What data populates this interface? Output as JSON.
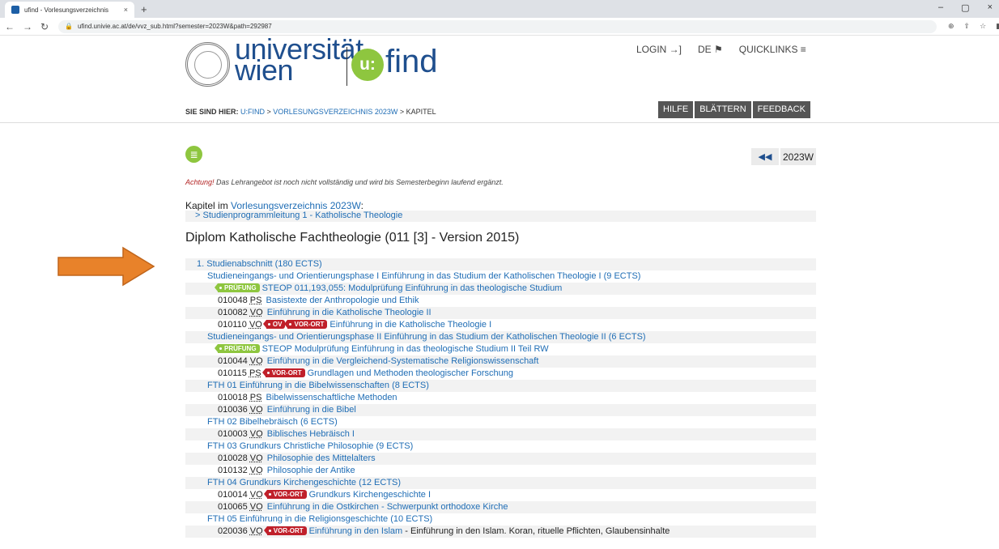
{
  "browser": {
    "tab_title": "ufind - Vorlesungsverzeichnis",
    "tab_close": "×",
    "new_tab": "+",
    "url": "ufind.univie.ac.at/de/vvz_sub.html?semester=2023W&path=292987",
    "win_min": "–",
    "win_max": "▢",
    "win_close": "×"
  },
  "header": {
    "logo_line1": "universität",
    "logo_line2": "wien",
    "ufind_mark": "u:",
    "ufind_text": "find",
    "login": "LOGIN →]",
    "lang": "DE ⚑",
    "quicklinks": "QUICKLINKS ≡",
    "breadcrumb_label": "SIE SIND HIER:",
    "breadcrumb_1": "U:FIND",
    "breadcrumb_2": "VORLESUNGSVERZEICHNIS 2023W",
    "breadcrumb_3": "KAPITEL",
    "btn_help": "HILFE",
    "btn_browse": "BLÄTTERN",
    "btn_feedback": "FEEDBACK"
  },
  "content": {
    "semester_back": "◀◀",
    "semester": "2023W",
    "warn_red": "Achtung!",
    "warn_text": " Das Lehrangebot ist noch nicht vollständig und wird bis Semesterbeginn laufend ergänzt.",
    "chapter_prefix": "Kapitel im ",
    "chapter_link": "Vorlesungsverzeichnis 2023W",
    "chapter_suffix": ":",
    "chapter_sub": "> Studienprogrammleitung 1 - Katholische Theologie",
    "title": "Diplom Katholische Fachtheologie (011 [3] - Version 2015)"
  },
  "tree": [
    {
      "lvl": 1,
      "text": "1. Studienabschnitt (180 ECTS)"
    },
    {
      "lvl": 2,
      "text": "Studieneingangs- und Orientierungsphase I Einführung in das Studium der Katholischen Theologie I (9 ECTS)"
    },
    {
      "lvl": 3,
      "badges": [
        [
          "green",
          "PRÜFUNG"
        ]
      ],
      "text": "STEOP 011,193,055: Modulprüfung Einführung in das theologische Studium"
    },
    {
      "lvl": 3,
      "num": "010048",
      "type": "PS",
      "text": "Basistexte der Anthropologie und Ethik"
    },
    {
      "lvl": 3,
      "num": "010082",
      "type": "VO",
      "text": "Einführung in die Katholische Theologie II"
    },
    {
      "lvl": 3,
      "num": "010110",
      "type": "VO",
      "badges": [
        [
          "red",
          "OV"
        ],
        [
          "red",
          "VOR-ORT"
        ]
      ],
      "text": "Einführung in die Katholische Theologie I"
    },
    {
      "lvl": 2,
      "text": "Studieneingangs- und Orientierungsphase II Einführung in das Studium der Katholischen Theologie II (6 ECTS)"
    },
    {
      "lvl": 3,
      "badges": [
        [
          "green",
          "PRÜFUNG"
        ]
      ],
      "text": "STEOP Modulprüfung Einführung in das theologische Studium II Teil RW"
    },
    {
      "lvl": 3,
      "num": "010044",
      "type": "VO",
      "text": "Einführung in die Vergleichend-Systematische Religionswissenschaft"
    },
    {
      "lvl": 3,
      "num": "010115",
      "type": "PS",
      "badges": [
        [
          "red",
          "VOR-ORT"
        ]
      ],
      "text": "Grundlagen und Methoden theologischer Forschung"
    },
    {
      "lvl": 2,
      "text": "FTH 01 Einführung in die Bibelwissenschaften (8 ECTS)"
    },
    {
      "lvl": 3,
      "num": "010018",
      "type": "PS",
      "text": "Bibelwissenschaftliche Methoden"
    },
    {
      "lvl": 3,
      "num": "010036",
      "type": "VO",
      "text": "Einführung in die Bibel"
    },
    {
      "lvl": 2,
      "text": "FTH 02 Bibelhebräisch (6 ECTS)"
    },
    {
      "lvl": 3,
      "num": "010003",
      "type": "VO",
      "text": "Biblisches Hebräisch I"
    },
    {
      "lvl": 2,
      "text": "FTH 03 Grundkurs Christliche Philosophie (9 ECTS)"
    },
    {
      "lvl": 3,
      "num": "010028",
      "type": "VO",
      "text": "Philosophie des Mittelalters"
    },
    {
      "lvl": 3,
      "num": "010132",
      "type": "VO",
      "text": "Philosophie der Antike"
    },
    {
      "lvl": 2,
      "text": "FTH 04 Grundkurs Kirchengeschichte (12 ECTS)"
    },
    {
      "lvl": 3,
      "num": "010014",
      "type": "VO",
      "badges": [
        [
          "red",
          "VOR-ORT"
        ]
      ],
      "text": "Grundkurs Kirchengeschichte I"
    },
    {
      "lvl": 3,
      "num": "010065",
      "type": "VO",
      "text": "Einführung in die Ostkirchen - Schwerpunkt orthodoxe Kirche"
    },
    {
      "lvl": 2,
      "text": "FTH 05 Einführung in die Religionsgeschichte (10 ECTS)"
    },
    {
      "lvl": 3,
      "num": "020036",
      "type": "VO",
      "badges": [
        [
          "red",
          "VOR-ORT"
        ]
      ],
      "text": "Einführung in den Islam",
      "extra": " - Einführung in den Islam. Koran, rituelle Pflichten, Glaubensinhalte"
    }
  ],
  "colors": {
    "brand_blue": "#1f4f8e",
    "link": "#1f6db5",
    "green": "#8ec63f",
    "red": "#c0202a",
    "arrow": "#e8822a"
  }
}
